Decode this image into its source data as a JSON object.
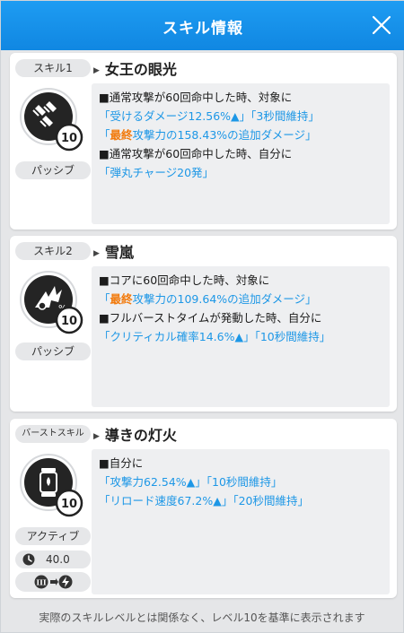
{
  "header": {
    "title": "スキル情報",
    "close_icon": "close-icon"
  },
  "skills": [
    {
      "tag": "スキル1",
      "name": "女王の眼光",
      "level": "10",
      "type": "パッシブ",
      "icon": "triple-bullet-icon",
      "lines": [
        [
          {
            "t": "■通常攻撃が60回命中した時、対象に",
            "c": ""
          }
        ],
        [
          {
            "t": "「受けるダメージ12.56%▲」「3秒間維持」",
            "c": "blue"
          }
        ],
        [
          {
            "t": "「",
            "c": "blue"
          },
          {
            "t": "最終",
            "c": "orange"
          },
          {
            "t": "攻撃力の158.43%の追加ダメージ」",
            "c": "blue"
          }
        ],
        [
          {
            "t": "■通常攻撃が60回命中した時、自分に",
            "c": ""
          }
        ],
        [
          {
            "t": "「弾丸チャージ20発」",
            "c": "blue"
          }
        ]
      ]
    },
    {
      "tag": "スキル2",
      "name": "雪嵐",
      "level": "10",
      "type": "パッシブ",
      "icon": "burst-percent-icon",
      "lines": [
        [
          {
            "t": "■コアに60回命中した時、対象に",
            "c": ""
          }
        ],
        [
          {
            "t": "「",
            "c": "blue"
          },
          {
            "t": "最終",
            "c": "orange"
          },
          {
            "t": "攻撃力の109.64%の追加ダメージ」",
            "c": "blue"
          }
        ],
        [
          {
            "t": "■フルバーストタイムが発動した時、自分に",
            "c": ""
          }
        ],
        [
          {
            "t": "「クリティカル確率14.6%▲」「10秒間維持」",
            "c": "blue"
          }
        ]
      ]
    },
    {
      "tag": "バーストスキル",
      "name": "導きの灯火",
      "level": "10",
      "type": "アクティブ",
      "icon": "lantern-icon",
      "cooldown": "40.0",
      "burst_stage": "III",
      "lines": [
        [
          {
            "t": "■自分に",
            "c": ""
          }
        ],
        [
          {
            "t": "「攻撃力62.54%▲」「10秒間維持」",
            "c": "blue"
          }
        ],
        [
          {
            "t": "「リロード速度67.2%▲」「20秒間維持」",
            "c": "blue"
          }
        ]
      ]
    }
  ],
  "footer": "実際のスキルレベルとは関係なく、レベル10を基準に表示されます",
  "colors": {
    "header": "#1a92ea",
    "highlight_blue": "#1d97e6",
    "highlight_orange": "#f27a0c"
  }
}
